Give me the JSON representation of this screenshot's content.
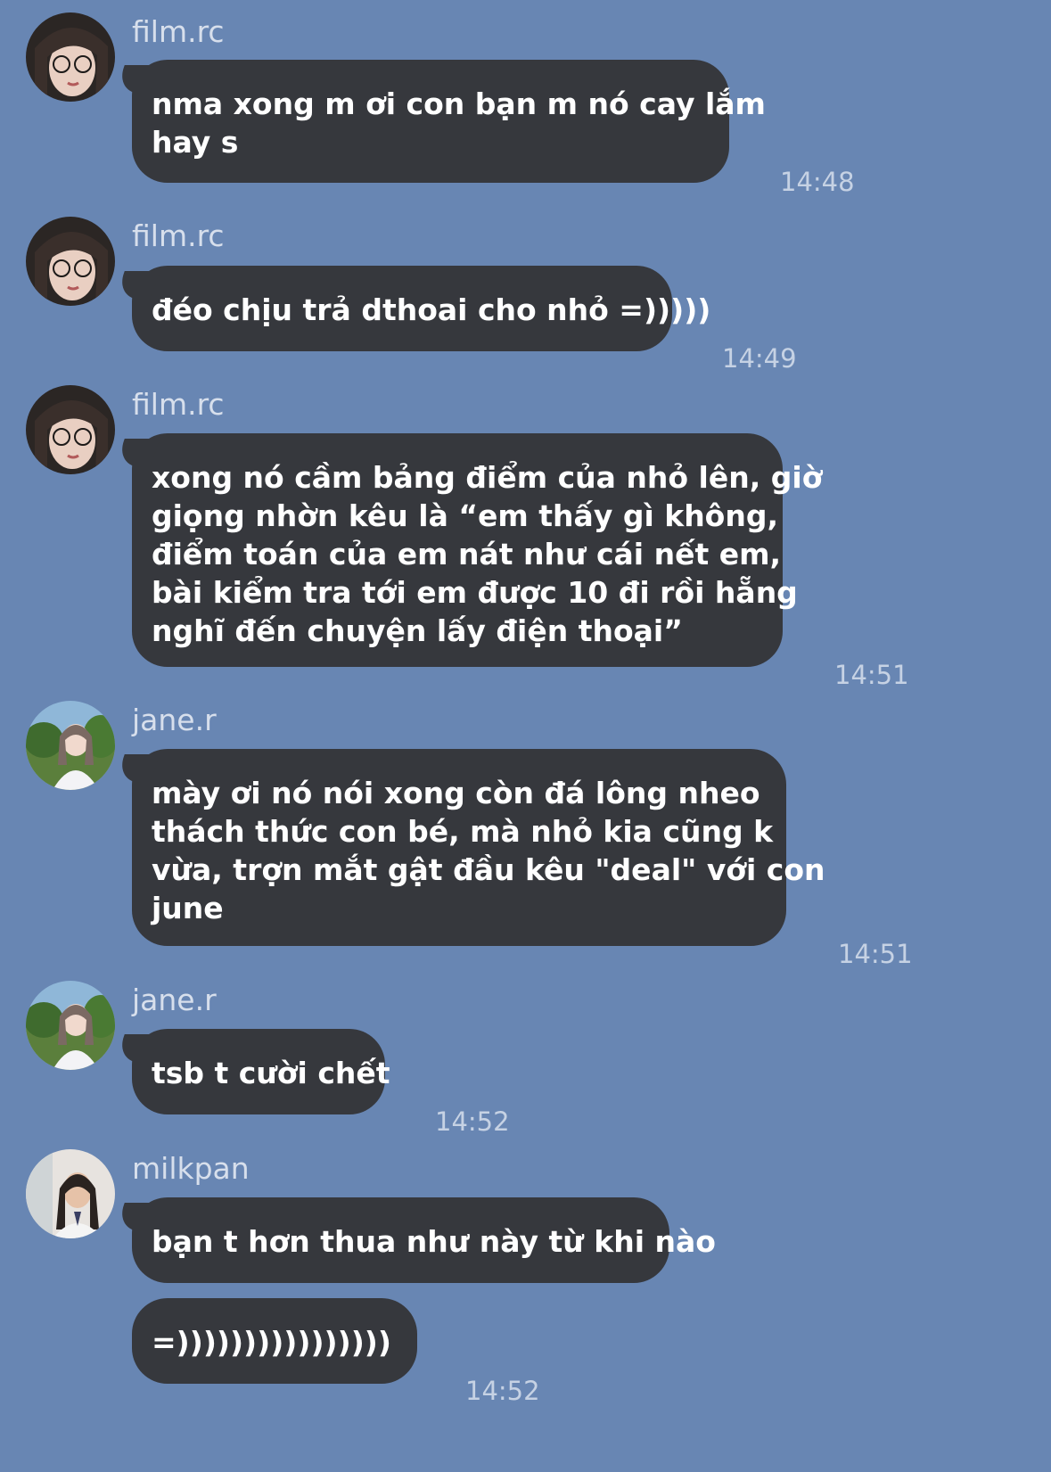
{
  "messages": [
    {
      "sender": "film.rc",
      "lines": [
        "nma xong m ơi con bạn m nó cay lắm",
        "hay s"
      ],
      "time": "14:48"
    },
    {
      "sender": "film.rc",
      "lines": [
        "đéo chịu trả dthoai cho nhỏ =)))))"
      ],
      "time": "14:49"
    },
    {
      "sender": "film.rc",
      "lines": [
        "xong nó cầm bảng điểm của nhỏ lên, giờ",
        "giọng nhờn kêu là “em thấy gì không,",
        "điểm toán của em nát như cái nết em,",
        "bài kiểm tra tới em được 10 đi rồi hẵng",
        "nghĩ đến chuyện lấy điện thoại”"
      ],
      "time": "14:51"
    },
    {
      "sender": "jane.r",
      "lines": [
        "mày ơi nó nói xong còn đá lông nheo",
        "thách thức con bé, mà nhỏ kia cũng k",
        "vừa, trợn mắt gật đầu kêu \"deal\" với con",
        "june"
      ],
      "time": "14:51"
    },
    {
      "sender": "jane.r",
      "lines": [
        "tsb t cười chết"
      ],
      "time": "14:52"
    },
    {
      "sender": "milkpan",
      "lines": [
        "bạn t hơn thua như này từ khi nào"
      ]
    },
    {
      "lines": [
        "=))))))))))))))))"
      ],
      "time": "14:52"
    }
  ],
  "avatar_icons": [
    "profile-photo-film-rc",
    "profile-photo-jane-r",
    "profile-photo-milkpan"
  ]
}
